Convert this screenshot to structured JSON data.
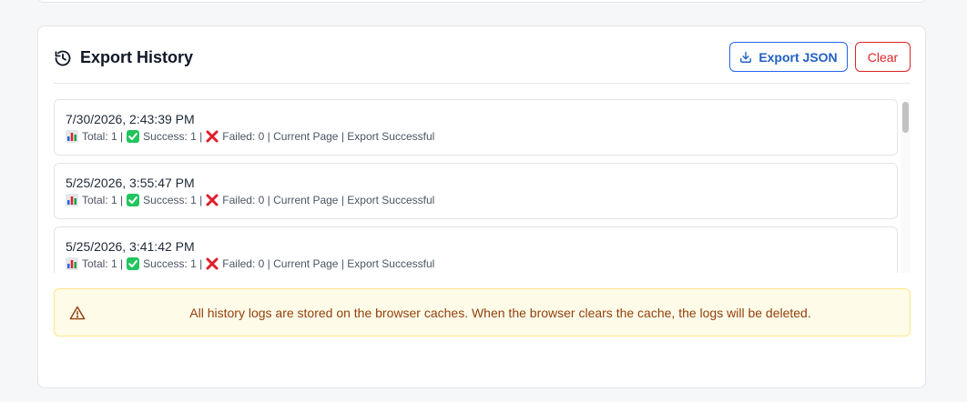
{
  "panel": {
    "title": "Export History",
    "title_icon": "history-icon",
    "export_label": "Export JSON",
    "export_icon": "download-icon",
    "clear_label": "Clear"
  },
  "entries": [
    {
      "timestamp": "7/30/2026, 2:43:39 PM",
      "total": "Total: 1 |",
      "success": "Success: 1 |",
      "failed": "Failed: 0 | Current Page | Export Successful"
    },
    {
      "timestamp": "5/25/2026, 3:55:47 PM",
      "total": "Total: 1 |",
      "success": "Success: 1 |",
      "failed": "Failed: 0 | Current Page | Export Successful"
    },
    {
      "timestamp": "5/25/2026, 3:41:42 PM",
      "total": "Total: 1 |",
      "success": "Success: 1 |",
      "failed": "Failed: 0 | Current Page | Export Successful"
    }
  ],
  "notice": {
    "icon": "warning-icon",
    "text": "All history logs are stored on the browser caches. When the browser clears the cache, the logs will be deleted."
  },
  "colors": {
    "accent": "#2563eb",
    "danger": "#dc2626",
    "notice_bg": "#fefce8",
    "notice_text": "#92400e"
  }
}
